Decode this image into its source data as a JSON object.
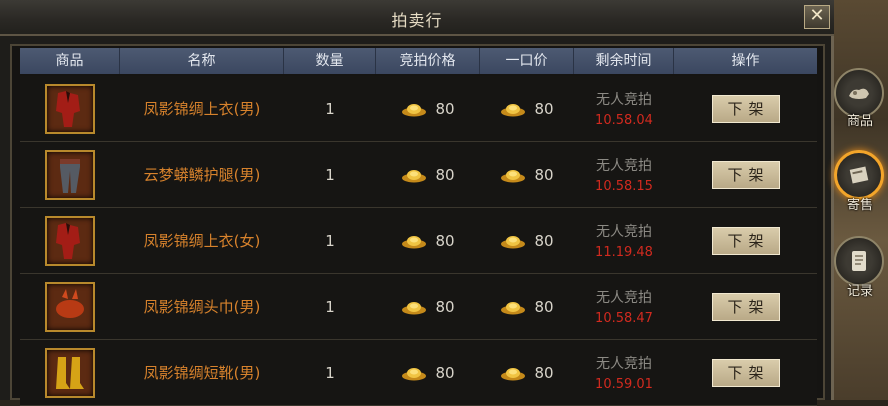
{
  "window": {
    "title": "拍卖行",
    "close_label": "✕"
  },
  "table": {
    "headers": [
      "商品",
      "名称",
      "数量",
      "竞拍价格",
      "一口价",
      "剩余时间",
      "操作"
    ],
    "rows": [
      {
        "name": "凤影锦绸上衣(男)",
        "qty": "1",
        "bid": "80",
        "buyout": "80",
        "status": "无人竞拍",
        "time": "10.58.04",
        "action": "下架",
        "item_icon": "robe-icon"
      },
      {
        "name": "云梦蟒鳞护腿(男)",
        "qty": "1",
        "bid": "80",
        "buyout": "80",
        "status": "无人竞拍",
        "time": "10.58.15",
        "action": "下架",
        "item_icon": "leggings-icon"
      },
      {
        "name": "凤影锦绸上衣(女)",
        "qty": "1",
        "bid": "80",
        "buyout": "80",
        "status": "无人竞拍",
        "time": "11.19.48",
        "action": "下架",
        "item_icon": "robe-icon"
      },
      {
        "name": "凤影锦绸头巾(男)",
        "qty": "1",
        "bid": "80",
        "buyout": "80",
        "status": "无人竞拍",
        "time": "10.58.47",
        "action": "下架",
        "item_icon": "headband-icon"
      },
      {
        "name": "凤影锦绸短靴(男)",
        "qty": "1",
        "bid": "80",
        "buyout": "80",
        "status": "无人竞拍",
        "time": "10.59.01",
        "action": "下架",
        "item_icon": "boots-icon"
      }
    ]
  },
  "side_tabs": [
    {
      "label": "商品",
      "icon": "goods-icon",
      "active": false
    },
    {
      "label": "寄售",
      "icon": "consign-icon",
      "active": true
    },
    {
      "label": "记录",
      "icon": "scroll-icon",
      "active": false
    }
  ],
  "colors": {
    "item_name": "#d7822c",
    "time": "#d12a1f",
    "tab_active": "#f3a52a"
  }
}
